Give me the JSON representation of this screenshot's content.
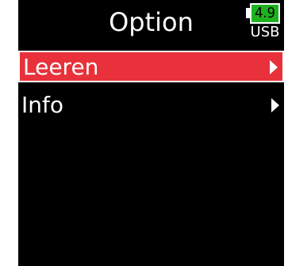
{
  "header": {
    "title": "Option",
    "battery": {
      "value": "4.9",
      "source": "USB"
    }
  },
  "menu": {
    "items": [
      {
        "label": "Leeren",
        "selected": true,
        "icon": "chevron-right-icon"
      },
      {
        "label": "Info",
        "selected": false,
        "icon": "chevron-right-icon"
      }
    ]
  },
  "colors": {
    "background": "#000000",
    "selection": "#e8313a",
    "battery": "#1fb21f",
    "text": "#ffffff"
  }
}
